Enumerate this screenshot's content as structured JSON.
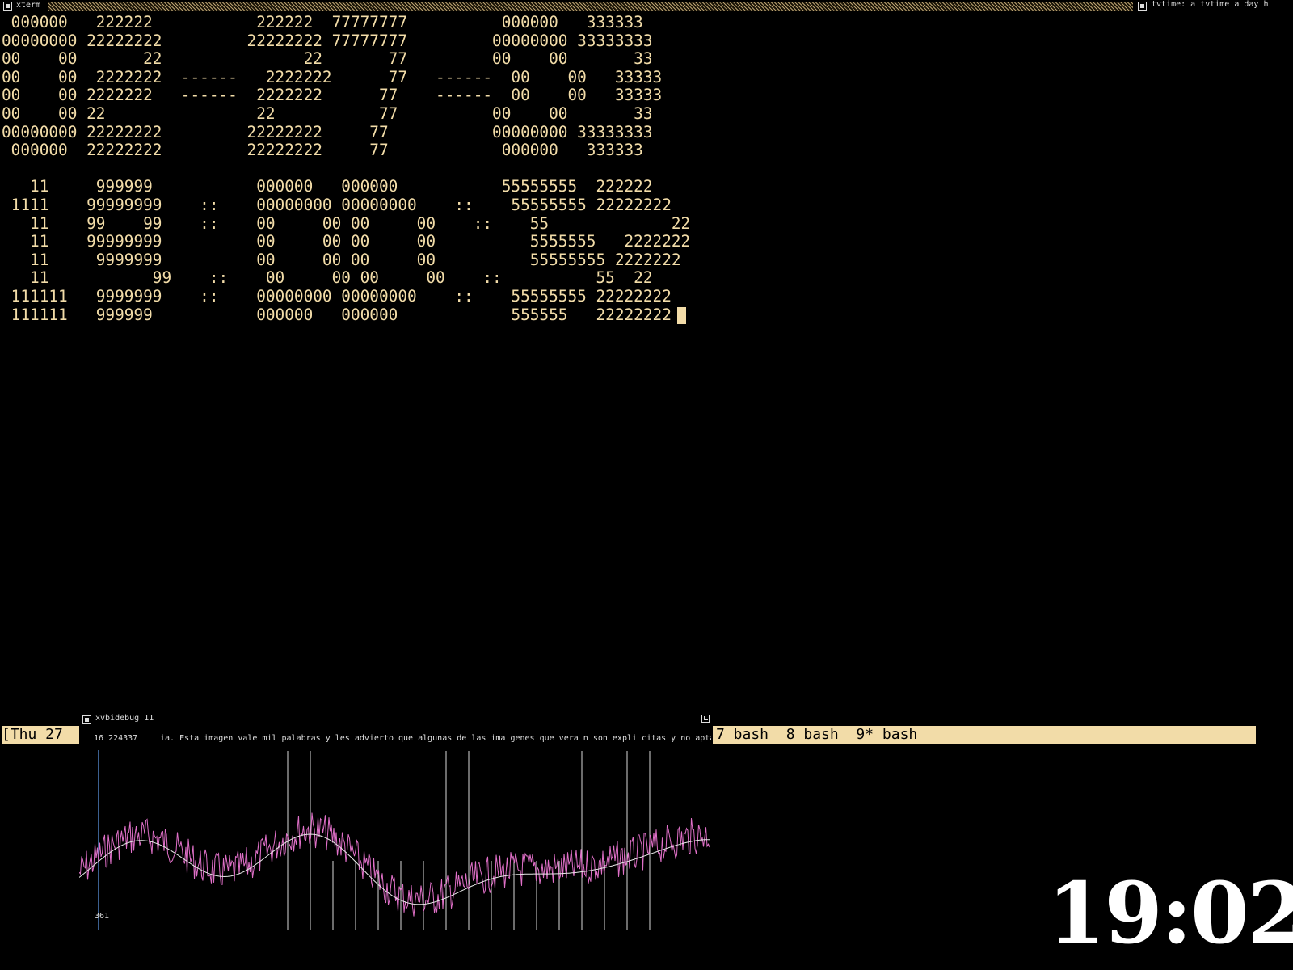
{
  "xterm": {
    "title": "xterm",
    "clock_lines": [
      " 000000   222222           222222  77777777          000000   333333",
      "00000000 22222222         22222222 77777777         00000000 33333333",
      "00    00       22               22       77         00    00       33",
      "00    00  2222222  ------   2222222      77   ------  00    00   33333",
      "00    00 2222222   ------  2222222      77    ------  00    00   33333",
      "00    00 22                22           77          00    00       33",
      "00000000 22222222         22222222     77           00000000 33333333",
      " 000000  22222222         22222222     77            000000   333333",
      "",
      "   11     999999           000000   000000           55555555  222222",
      " 1111    99999999    ::    00000000 00000000    ::    55555555 22222222",
      "   11    99    99    ::    00     00 00     00    ::    55             22",
      "   11    99999999          00     00 00     00          5555555   2222222",
      "   11     9999999          00     00 00     00          55555555 2222222",
      "   11           99    ::    00     00 00     00    ::          55  22",
      " 111111   9999999    ::    00000000 00000000    ::    55555555 22222222",
      " 111111   999999           000000   000000            555555   22222222"
    ]
  },
  "tvtime": {
    "title": "tvtime: a tvtime a day h"
  },
  "screen_status": {
    "left": "[Thu 27",
    "windows": "7 bash  8 bash  9* bash"
  },
  "xvbidebug": {
    "title": "xvbidebug 11",
    "counter": "16 224337",
    "caption": "ia. Esta imagen vale mil palabras y les advierto que algunas de las ima genes que vera n son expli citas y no aptas p",
    "plot_label": "361"
  },
  "clock": {
    "time": "19:02"
  },
  "colors": {
    "terminal_fg": "#f2dca8",
    "trace_pink": "#e070c8",
    "trace_white": "#e8e8e8",
    "marker_blue": "#5080c0"
  }
}
